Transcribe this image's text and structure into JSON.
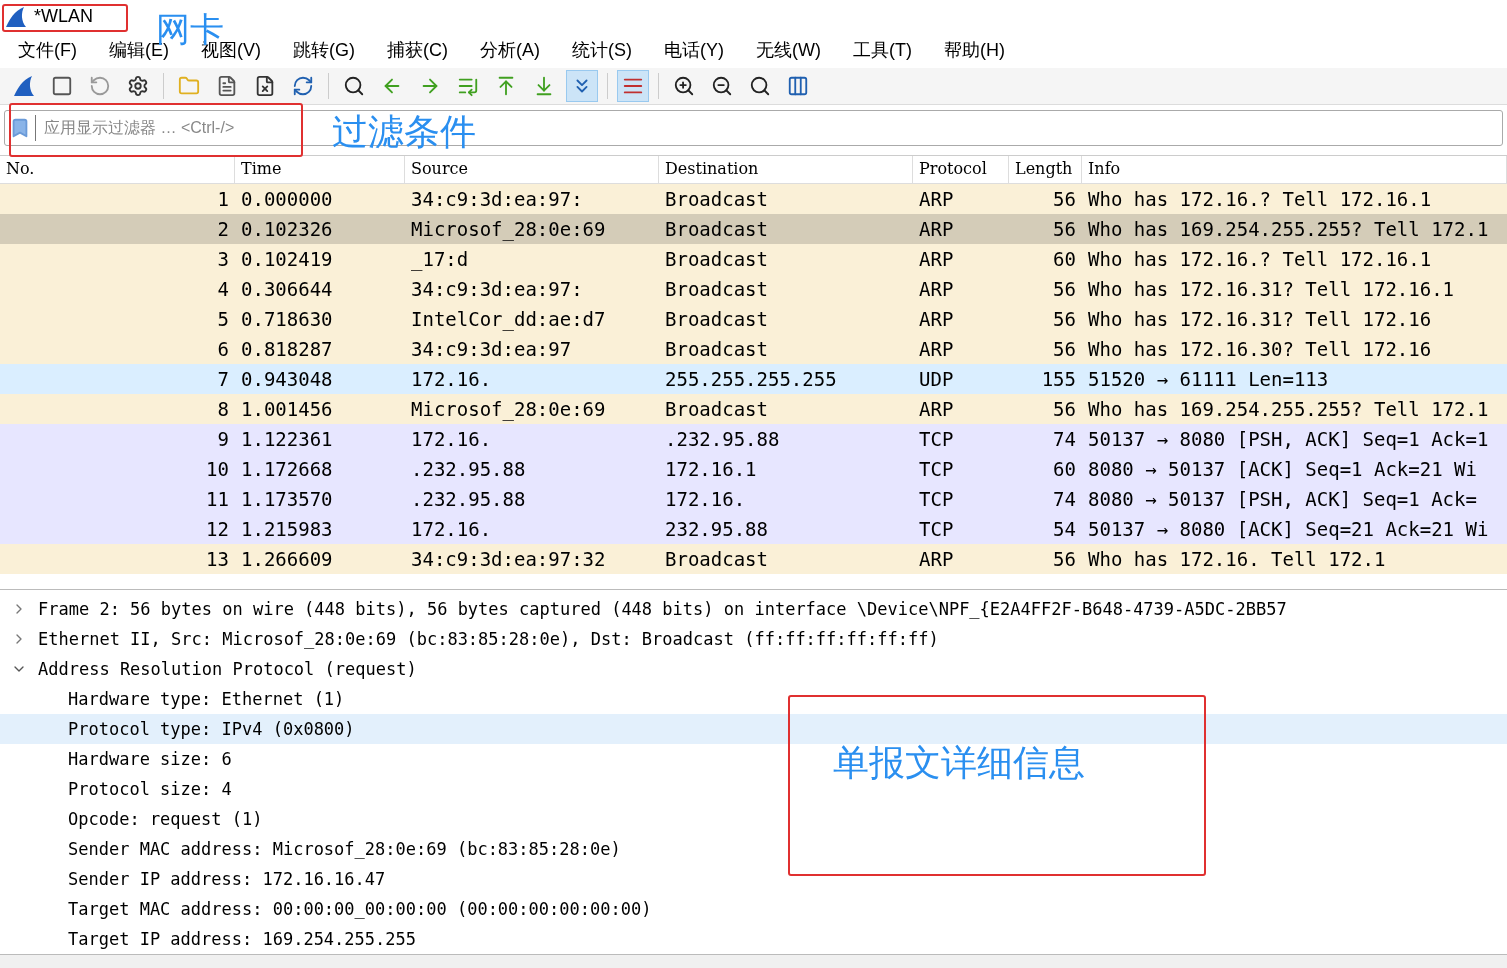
{
  "window": {
    "title": "*WLAN"
  },
  "menu": [
    "文件(F)",
    "编辑(E)",
    "视图(V)",
    "跳转(G)",
    "捕获(C)",
    "分析(A)",
    "统计(S)",
    "电话(Y)",
    "无线(W)",
    "工具(T)",
    "帮助(H)"
  ],
  "toolbar": [
    {
      "kind": "fin",
      "selected": false
    },
    {
      "kind": "stop",
      "selected": false
    },
    {
      "kind": "restart",
      "selected": false
    },
    {
      "kind": "options",
      "selected": false
    },
    {
      "kind": "sep"
    },
    {
      "kind": "folder",
      "selected": false
    },
    {
      "kind": "file",
      "selected": false
    },
    {
      "kind": "close",
      "selected": false
    },
    {
      "kind": "reload",
      "selected": false
    },
    {
      "kind": "sep"
    },
    {
      "kind": "find",
      "selected": false
    },
    {
      "kind": "back",
      "selected": false
    },
    {
      "kind": "forward",
      "selected": false
    },
    {
      "kind": "goto",
      "selected": false
    },
    {
      "kind": "first",
      "selected": false
    },
    {
      "kind": "last",
      "selected": false
    },
    {
      "kind": "autoscroll",
      "selected": true
    },
    {
      "kind": "sep"
    },
    {
      "kind": "colorize",
      "selected": true
    },
    {
      "kind": "sep"
    },
    {
      "kind": "zoomin",
      "selected": false
    },
    {
      "kind": "zoomout",
      "selected": false
    },
    {
      "kind": "zoomreset",
      "selected": false
    },
    {
      "kind": "columns",
      "selected": false
    }
  ],
  "filter": {
    "placeholder": "应用显示过滤器 … <Ctrl-/>"
  },
  "table": {
    "columns": [
      "No.",
      "Time",
      "Source",
      "Destination",
      "Protocol",
      "Length",
      "Info"
    ],
    "rows": [
      {
        "kind": "arp",
        "selected": false,
        "cells": [
          "1",
          "0.000000",
          "34:c9:3d:ea:97:",
          "Broadcast",
          "ARP",
          "56",
          "Who has 172.16.? Tell 172.16.1"
        ]
      },
      {
        "kind": "arp",
        "selected": true,
        "cells": [
          "2",
          "0.102326",
          "Microsof_28:0e:69",
          "Broadcast",
          "ARP",
          "56",
          "Who has 169.254.255.255? Tell 172.1"
        ]
      },
      {
        "kind": "arp",
        "selected": false,
        "cells": [
          "3",
          "0.102419",
          "_17:d",
          "Broadcast",
          "ARP",
          "60",
          "Who has 172.16.? Tell 172.16.1"
        ]
      },
      {
        "kind": "arp",
        "selected": false,
        "cells": [
          "4",
          "0.306644",
          "34:c9:3d:ea:97:",
          "Broadcast",
          "ARP",
          "56",
          "Who has 172.16.31? Tell 172.16.1"
        ]
      },
      {
        "kind": "arp",
        "selected": false,
        "cells": [
          "5",
          "0.718630",
          "IntelCor_dd:ae:d7",
          "Broadcast",
          "ARP",
          "56",
          "Who has 172.16.31? Tell 172.16"
        ]
      },
      {
        "kind": "arp",
        "selected": false,
        "cells": [
          "6",
          "0.818287",
          "34:c9:3d:ea:97",
          "Broadcast",
          "ARP",
          "56",
          "Who has 172.16.30? Tell 172.16"
        ]
      },
      {
        "kind": "udp",
        "selected": false,
        "cells": [
          "7",
          "0.943048",
          "172.16.",
          "255.255.255.255",
          "UDP",
          "155",
          "51520 → 61111 Len=113"
        ]
      },
      {
        "kind": "arp",
        "selected": false,
        "cells": [
          "8",
          "1.001456",
          "Microsof_28:0e:69",
          "Broadcast",
          "ARP",
          "56",
          "Who has 169.254.255.255? Tell 172.1"
        ]
      },
      {
        "kind": "tcp",
        "selected": false,
        "cells": [
          "9",
          "1.122361",
          "172.16.",
          ".232.95.88",
          "TCP",
          "74",
          "50137 → 8080 [PSH, ACK] Seq=1 Ack=1"
        ]
      },
      {
        "kind": "tcp",
        "selected": false,
        "cells": [
          "10",
          "1.172668",
          ".232.95.88",
          "172.16.1",
          "TCP",
          "60",
          "8080 → 50137 [ACK] Seq=1 Ack=21 Wi"
        ]
      },
      {
        "kind": "tcp",
        "selected": false,
        "cells": [
          "11",
          "1.173570",
          ".232.95.88",
          "172.16.",
          "TCP",
          "74",
          "8080 → 50137 [PSH, ACK] Seq=1 Ack="
        ]
      },
      {
        "kind": "tcp",
        "selected": false,
        "cells": [
          "12",
          "1.215983",
          "172.16.",
          "232.95.88",
          "TCP",
          "54",
          "50137 → 8080 [ACK] Seq=21 Ack=21 Wi"
        ]
      },
      {
        "kind": "arp",
        "selected": false,
        "cells": [
          "13",
          "1.266609",
          "34:c9:3d:ea:97:32",
          "Broadcast",
          "ARP",
          "56",
          "Who has 172.16. Tell 172.1"
        ]
      }
    ]
  },
  "details": [
    {
      "text": "Frame 2: 56 bytes on wire (448 bits), 56 bytes captured (448 bits) on interface \\Device\\NPF_{E2A4FF2F-B648-4739-A5DC-2BB57",
      "expanded": false,
      "selected": false
    },
    {
      "text": "Ethernet II, Src: Microsof_28:0e:69 (bc:83:85:28:0e), Dst: Broadcast (ff:ff:ff:ff:ff:ff)",
      "expanded": false,
      "selected": false
    },
    {
      "text": "Address Resolution Protocol (request)",
      "expanded": true,
      "selected": false,
      "children": [
        {
          "text": "Hardware type: Ethernet (1)",
          "selected": false
        },
        {
          "text": "Protocol type: IPv4 (0x0800)",
          "selected": true
        },
        {
          "text": "Hardware size: 6",
          "selected": false
        },
        {
          "text": "Protocol size: 4",
          "selected": false
        },
        {
          "text": "Opcode: request (1)",
          "selected": false
        },
        {
          "text": "Sender MAC address: Microsof_28:0e:69 (bc:83:85:28:0e)",
          "selected": false
        },
        {
          "text": "Sender IP address: 172.16.16.47",
          "selected": false
        },
        {
          "text": "Target MAC address: 00:00:00_00:00:00 (00:00:00:00:00:00)",
          "selected": false
        },
        {
          "text": "Target IP address: 169.254.255.255",
          "selected": false
        }
      ]
    }
  ],
  "annotations": [
    "网卡",
    "过滤条件",
    "单报文详细信息"
  ]
}
